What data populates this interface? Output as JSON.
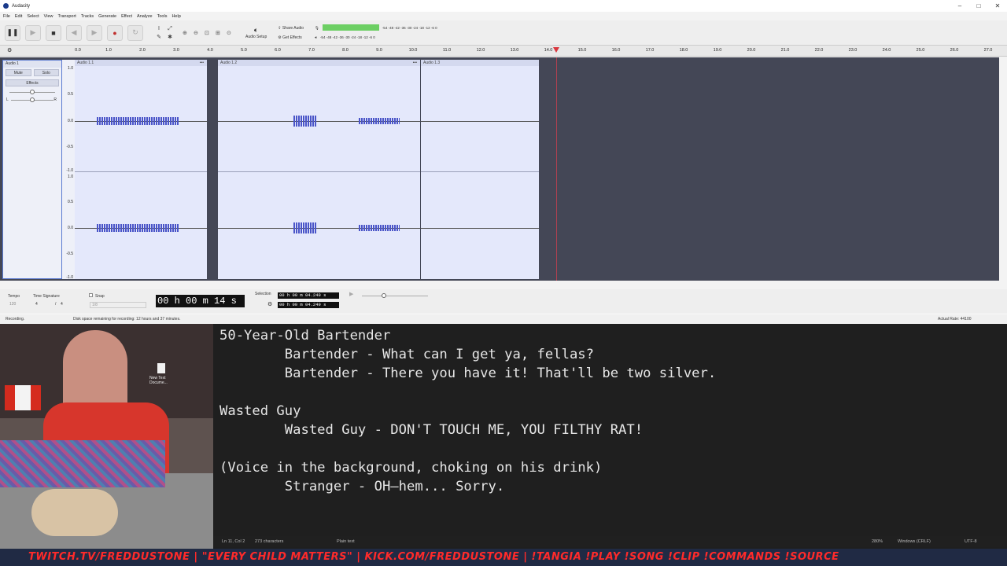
{
  "window": {
    "title": "Audacity"
  },
  "menu": [
    "File",
    "Edit",
    "Select",
    "View",
    "Transport",
    "Tracks",
    "Generate",
    "Effect",
    "Analyze",
    "Tools",
    "Help"
  ],
  "toolbar": {
    "audio_setup": "Audio Setup",
    "share_audio": "Share Audio",
    "get_effects": "Get Effects"
  },
  "meters": {
    "rec_scale": "-54  -48  -42  -36  -30  -24  -18  -12  -6  0",
    "play_scale": "-54  -48  -42  -36  -30  -24  -18  -12  -6  0"
  },
  "ruler": {
    "ticks": [
      "0.0",
      "1.0",
      "2.0",
      "3.0",
      "4.0",
      "5.0",
      "6.0",
      "7.0",
      "8.0",
      "9.0",
      "10.0",
      "11.0",
      "12.0",
      "13.0",
      "14.0",
      "15.0",
      "16.0",
      "17.0",
      "18.0",
      "19.0",
      "20.0",
      "21.0",
      "22.0",
      "23.0",
      "24.0",
      "25.0",
      "26.0",
      "27.0"
    ]
  },
  "track": {
    "name": "Audio 1",
    "mute": "Mute",
    "solo": "Solo",
    "effects": "Effects",
    "gain_left": "L",
    "gain_right": "R"
  },
  "yaxis": [
    "1.0",
    "0.5",
    "0.0",
    "-0.5",
    "-1.0",
    "1.0",
    "0.5",
    "0.0",
    "-0.5",
    "-1.0"
  ],
  "clips": [
    "Audio 1.1",
    "Audio 1.2",
    "Audio 1.3"
  ],
  "bottom": {
    "tempo_label": "Tempo",
    "tempo_value": "120",
    "time_sig_label": "Time Signature",
    "time_sig_num": "4",
    "time_sig_den": "4",
    "snap_label": "Snap",
    "snap_value": "1/8",
    "time_display": "00 h 00 m 14 s",
    "selection_label": "Selection",
    "sel_start": "00 h 00 m 04.249 s",
    "sel_end": "00 h 00 m 04.249 s"
  },
  "status": {
    "left": "Recording.",
    "disk": "Disk space remaining for recording: 12 hours and 37 minutes.",
    "rate": "Actual Rate: 44100"
  },
  "editor": {
    "lines": [
      "50-Year-Old Bartender",
      "        Bartender - What can I get ya, fellas?",
      "        Bartender - There you have it! That'll be two silver.",
      "",
      "Wasted Guy",
      "        Wasted Guy - DON'T TOUCH ME, YOU FILTHY RAT!",
      "",
      "(Voice in the background, choking on his drink)",
      "        Stranger - OH—hem... Sorry."
    ],
    "status": {
      "position": "Ln 11, Col 2",
      "chars": "273 characters",
      "format": "Plain text",
      "zoom": "280%",
      "line_endings": "Windows (CRLF)",
      "encoding": "UTF-8"
    }
  },
  "desktop_icon": "New Text Docume...",
  "ticker": "TWITCH.TV/FREDDUSTONE  |  \"EVERY CHILD MATTERS\"  |  KICK.COM/FREDDUSTONE  |  !TANGIA !PLAY !SONG !CLIP !COMMANDS !SOURCE"
}
